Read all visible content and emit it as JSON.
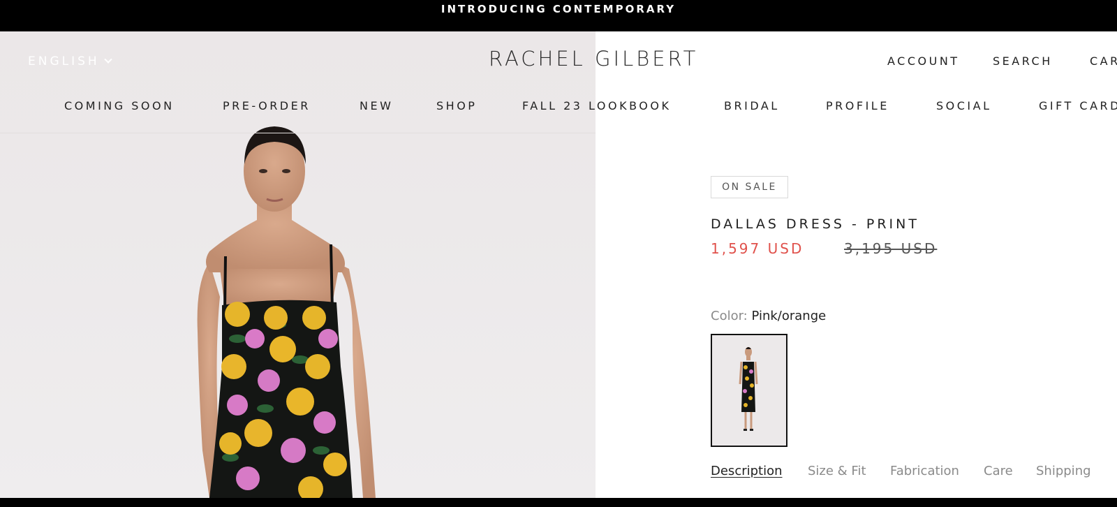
{
  "announcement": "INTRODUCING CONTEMPORARY",
  "header": {
    "language": "ENGLISH",
    "logo": "RACHEL GILBERT",
    "utility": {
      "account": "ACCOUNT",
      "search": "SEARCH",
      "cart": "CART"
    }
  },
  "nav": [
    {
      "label": "COMING SOON"
    },
    {
      "label": "PRE-ORDER"
    },
    {
      "label": "NEW"
    },
    {
      "label": "SHOP"
    },
    {
      "label": "FALL 23 LOOKBOOK"
    },
    {
      "label": "BRIDAL"
    },
    {
      "label": "PROFILE"
    },
    {
      "label": "SOCIAL"
    },
    {
      "label": "GIFT CARD"
    }
  ],
  "product": {
    "badge": "ON SALE",
    "title": "DALLAS DRESS - PRINT",
    "sale_price": "1,597 USD",
    "original_price": "3,195 USD",
    "color_label": "Color:",
    "color_value": "Pink/orange"
  },
  "tabs": [
    {
      "label": "Description",
      "active": true
    },
    {
      "label": "Size & Fit"
    },
    {
      "label": "Fabrication"
    },
    {
      "label": "Care"
    },
    {
      "label": "Shipping"
    }
  ],
  "colors": {
    "sale": "#e0514b",
    "text": "#222222",
    "muted": "#8a8a8a"
  }
}
